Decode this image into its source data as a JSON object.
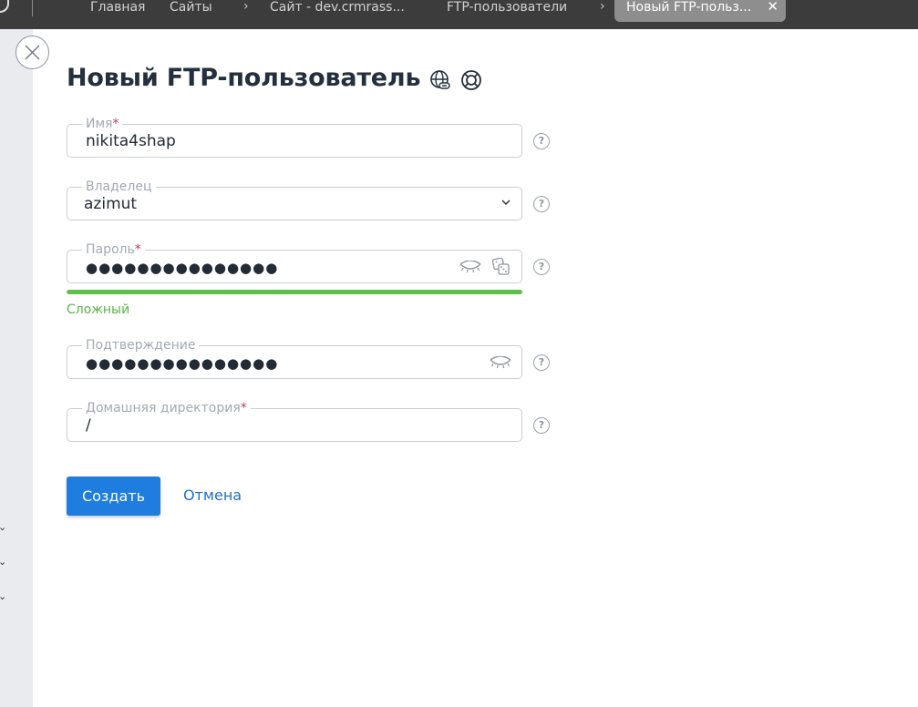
{
  "breadcrumbs": {
    "home": "Главная",
    "sites": "Сайты",
    "site": "Сайт - dev.crmrass...",
    "ftp_users": "FTP-пользователи",
    "current": "Новый FTP-польз..."
  },
  "icons": {
    "close": "close-icon",
    "title_icon_1": "globe-link-icon",
    "title_icon_2": "lifebuoy-icon"
  },
  "page": {
    "title": "Новый FTP-пользователь"
  },
  "form": {
    "name": {
      "label": "Имя",
      "required": "*",
      "value": "nikita4shap"
    },
    "owner": {
      "label": "Владелец",
      "value": "azimut"
    },
    "password": {
      "label": "Пароль",
      "required": "*",
      "value": "●●●●●●●●●●●●●●●"
    },
    "strength": {
      "text": "Сложный",
      "level": 1.0,
      "color": "#5ec04a"
    },
    "confirm": {
      "label": "Подтверждение",
      "value": "●●●●●●●●●●●●●●●"
    },
    "home_dir": {
      "label": "Домашняя директория",
      "required": "*",
      "value": "/"
    },
    "help": "?"
  },
  "actions": {
    "create": "Создать",
    "cancel": "Отмена"
  },
  "colors": {
    "accent": "#1f7de0",
    "topbar": "#3c3c3c",
    "required": "#c0395a",
    "success": "#5ec04a"
  }
}
